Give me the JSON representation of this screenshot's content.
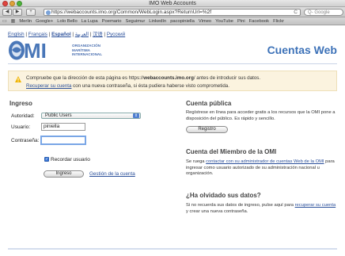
{
  "window": {
    "title": "IMO Web Accounts"
  },
  "toolbar": {
    "url": "https://webaccounts.imo.org/Common/WebLogin.aspx?ReturnUrl=%2f",
    "search_placeholder": "Q- Google",
    "reload_glyph": "C"
  },
  "bookmarks": [
    "Merlin",
    "Google+",
    "Lolo Bello",
    "La Lupa",
    "Poemario",
    "Seguimur",
    "LinkedIn",
    "pacopiniella",
    "Vimeo",
    "YouTube",
    "Pini",
    "Facebook",
    "Flickr"
  ],
  "languages": [
    {
      "label": "English",
      "active": false
    },
    {
      "label": "Français",
      "active": false
    },
    {
      "label": "Español",
      "active": true
    },
    {
      "label": "العربية",
      "active": false
    },
    {
      "label": "汉语",
      "active": false
    },
    {
      "label": "Русский",
      "active": false
    }
  ],
  "header": {
    "org_line1": "ORGANIZACIÓN",
    "org_line2": "MARÍTIMA",
    "org_line3": "INTERNACIONAL",
    "title": "Cuentas Web"
  },
  "notice": {
    "line1_pre": "Compruebe que la dirección de esta página es https://",
    "line1_bold": "webaccounts.imo.org",
    "line1_post": "/ antes de introducir sus datos.",
    "line2_link": "Recuperar su cuenta",
    "line2_post": " con una nueva contraseña, si ésta pudiera haberse visto comprometida."
  },
  "login": {
    "heading": "Ingreso",
    "authority_label": "Autoridad:",
    "authority_value": "Public Users",
    "user_label": "Usuario:",
    "user_value": "piniella",
    "password_label": "Contraseña:",
    "remember_label": "Recordar usuario",
    "submit_label": "Ingreso",
    "manage_link": "Gestión de la cuenta"
  },
  "public": {
    "heading": "Cuenta pública",
    "text": "Regístrese en línea para acceder gratis a los recursos que la OMI pone a disposición del público. Es rápido y sencillo.",
    "register_label": "Registro"
  },
  "member": {
    "heading": "Cuenta del Miembro de la OMI",
    "text_pre": "Se ruega ",
    "text_link": "contactar con su administrador de cuentas Web de la OMI",
    "text_post": " para ingresar como usuario autorizado de su administración nacional u organización."
  },
  "forgot": {
    "heading": "¿Ha olvidado sus datos?",
    "text_pre": "Si no recuerda sus datos de ingreso, pulse aquí para ",
    "text_link": "recuperar su cuenta",
    "text_post": " y crear una nueva contraseña."
  },
  "colors": {
    "accent": "#3d72b8",
    "link": "#2a4f9a",
    "notice_bg": "#fbf3df"
  }
}
